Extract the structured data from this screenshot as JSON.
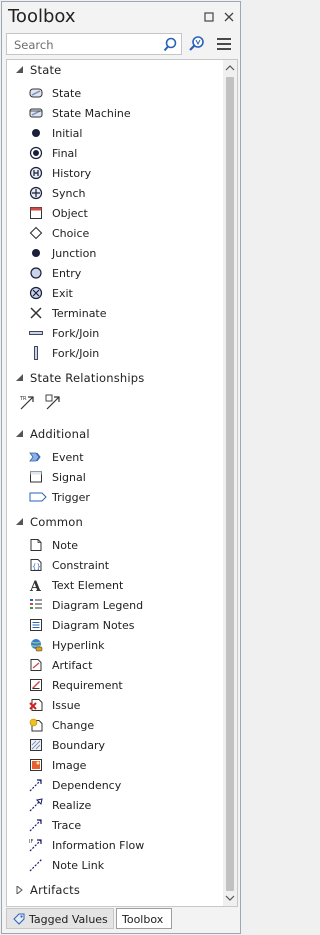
{
  "window": {
    "title": "Toolbox"
  },
  "search": {
    "placeholder": "Search"
  },
  "sections": {
    "state": {
      "label": "State",
      "items": [
        "State",
        "State Machine",
        "Initial",
        "Final",
        "History",
        "Synch",
        "Object",
        "Choice",
        "Junction",
        "Entry",
        "Exit",
        "Terminate",
        "Fork/Join",
        "Fork/Join"
      ]
    },
    "state_relationships": {
      "label": "State Relationships"
    },
    "additional": {
      "label": "Additional",
      "items": [
        "Event",
        "Signal",
        "Trigger"
      ]
    },
    "common": {
      "label": "Common",
      "items": [
        "Note",
        "Constraint",
        "Text Element",
        "Diagram Legend",
        "Diagram Notes",
        "Hyperlink",
        "Artifact",
        "Requirement",
        "Issue",
        "Change",
        "Boundary",
        "Image",
        "Dependency",
        "Realize",
        "Trace",
        "Information Flow",
        "Note Link"
      ]
    },
    "artifacts": {
      "label": "Artifacts"
    }
  },
  "tabs": {
    "tagged_values": "Tagged Values",
    "toolbox": "Toolbox"
  },
  "colors": {
    "accent": "#2a62b8",
    "border": "#c8c8c8"
  }
}
